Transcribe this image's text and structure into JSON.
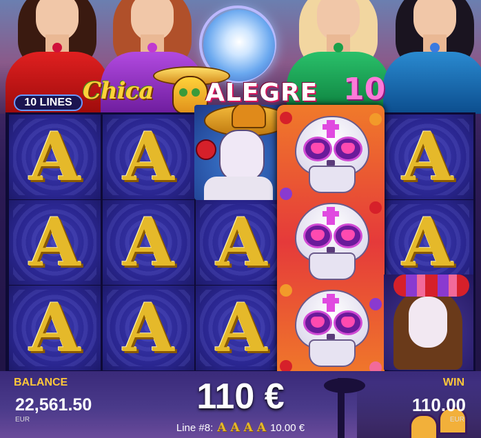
{
  "game": {
    "logo_part1": "Chica",
    "logo_part2": "ALEGRE",
    "logo_part3": "10",
    "lines_label": "10 LINES"
  },
  "reels": {
    "symbols": [
      [
        "A",
        "A",
        "A"
      ],
      [
        "A",
        "A",
        "A"
      ],
      [
        "mariachi",
        "A",
        "A"
      ],
      [
        "skull-wild",
        "skull-wild",
        "skull-wild"
      ],
      [
        "A",
        "A",
        "catrina"
      ]
    ],
    "a_symbol": "A"
  },
  "hud": {
    "balance_label": "BALANCE",
    "balance_value": "22,561.50",
    "balance_currency": "EUR",
    "win_label": "WIN",
    "win_value": "110.00",
    "win_currency": "EUR",
    "total_win": "110 €",
    "line_text": "Line #8:",
    "line_symbols": [
      "A",
      "A",
      "A",
      "A"
    ],
    "line_amount": "10.00 €"
  },
  "colors": {
    "reel_bg": "#2a2690",
    "gold": "#e5b92a",
    "label_yellow": "#ffc83a"
  }
}
